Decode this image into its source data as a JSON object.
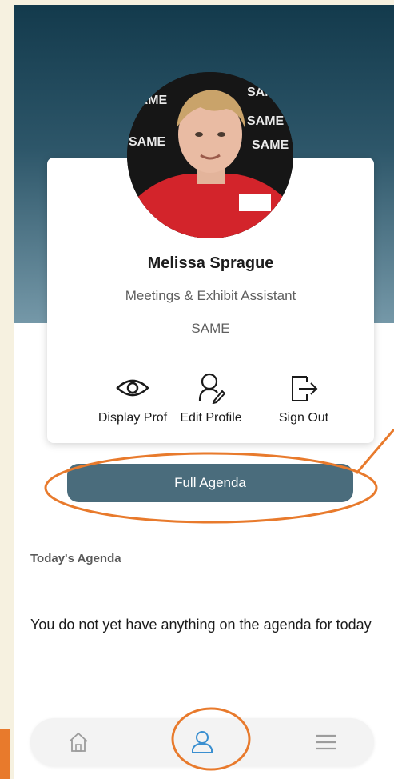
{
  "profile": {
    "name": "Melissa Sprague",
    "title": "Meetings & Exhibit Assistant",
    "organization": "SAME",
    "avatar_backdrop_text": "SAME"
  },
  "actions": {
    "display_profile": "Display Prof",
    "edit_profile": "Edit Profile",
    "sign_out": "Sign Out"
  },
  "buttons": {
    "full_agenda": "Full Agenda"
  },
  "agenda": {
    "heading": "Today's Agenda",
    "empty_message": "You do not yet have anything on the agenda for today"
  },
  "bottom_nav": {
    "items": [
      {
        "icon": "home-icon",
        "active": false
      },
      {
        "icon": "profile-icon",
        "active": true
      },
      {
        "icon": "menu-icon",
        "active": false
      }
    ]
  },
  "colors": {
    "header_top": "#133a4c",
    "header_bottom": "#7598a8",
    "agenda_button": "#4a6c7c",
    "annotation": "#e87a2c",
    "active_nav": "#3a8fd0"
  }
}
